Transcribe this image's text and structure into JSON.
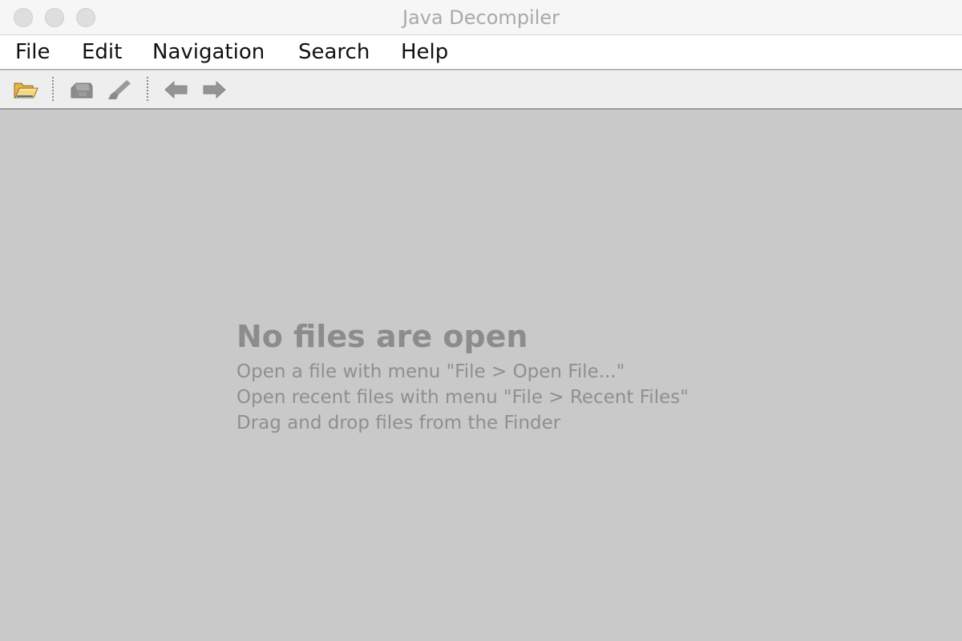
{
  "window": {
    "title": "Java Decompiler"
  },
  "menu": {
    "items": [
      {
        "label": "File"
      },
      {
        "label": "Edit"
      },
      {
        "label": "Navigation"
      },
      {
        "label": "Search"
      },
      {
        "label": "Help"
      }
    ]
  },
  "toolbar": {
    "buttons": [
      {
        "icon": "open-folder-icon",
        "enabled": true
      },
      {
        "icon": "save-icon",
        "enabled": false
      },
      {
        "icon": "clear-icon",
        "enabled": false
      },
      {
        "icon": "back-arrow-icon",
        "enabled": false
      },
      {
        "icon": "forward-arrow-icon",
        "enabled": false
      }
    ]
  },
  "empty_state": {
    "title": "No files are open",
    "lines": [
      "Open a file with menu \"File > Open File...\"",
      "Open recent files with menu \"File > Recent Files\"",
      "Drag and drop files from the Finder"
    ]
  },
  "colors": {
    "background": "#c9c9c9",
    "titlebar": "#f6f6f6",
    "menubar": "#ffffff",
    "toolbar": "#eeeeee",
    "empty_text": "#8c8c8c",
    "folder_icon": "#f4c86a"
  }
}
